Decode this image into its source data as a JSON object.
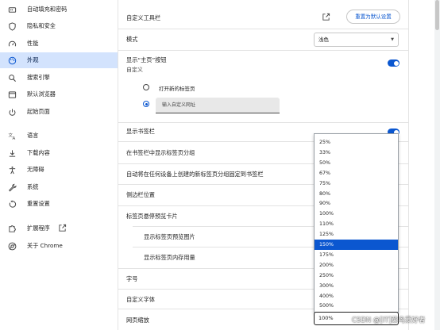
{
  "sidebar": {
    "items": [
      {
        "label": "自动填充和密码",
        "icon": "autofill-icon"
      },
      {
        "label": "隐私和安全",
        "icon": "shield-icon"
      },
      {
        "label": "性能",
        "icon": "speedometer-icon"
      },
      {
        "label": "外观",
        "icon": "palette-icon"
      },
      {
        "label": "搜索引擎",
        "icon": "search-icon"
      },
      {
        "label": "默认浏览器",
        "icon": "browser-window-icon"
      },
      {
        "label": "起始页面",
        "icon": "power-icon"
      },
      {
        "label": "语言",
        "icon": "translate-icon"
      },
      {
        "label": "下载内容",
        "icon": "download-icon"
      },
      {
        "label": "无障碍",
        "icon": "accessibility-icon"
      },
      {
        "label": "系统",
        "icon": "wrench-icon"
      },
      {
        "label": "重置设置",
        "icon": "reset-icon"
      },
      {
        "label": "扩展程序",
        "icon": "puzzle-icon"
      },
      {
        "label": "关于 Chrome",
        "icon": "chrome-icon"
      }
    ],
    "active_item": "外观"
  },
  "settings": {
    "custom_toolbar": {
      "label": "自定义工具栏",
      "reset_button": "重置为默认设置"
    },
    "mode": {
      "label": "模式",
      "value": "浅色"
    },
    "home_button": {
      "label": "显示“主页”按钮",
      "sub": "自定义",
      "enabled": true
    },
    "home_options": {
      "new_tab": "打开新的标签页",
      "custom_url_placeholder": "输入自定义网址"
    },
    "bookmarks_bar": {
      "label": "显示书签栏",
      "enabled": true
    },
    "tab_groups_in_bookmarks": {
      "label": "在书签栏中显示标签页分组"
    },
    "auto_pin_tab_groups": {
      "label": "自动将在任何设备上创建的新标签页分组固定到书签栏"
    },
    "side_panel_position": {
      "label": "侧边栏位置"
    },
    "tab_hover_preview": {
      "label": "标签页悬停预览卡片"
    },
    "show_tab_preview_image": {
      "label": "显示标签页预览图片"
    },
    "show_tab_memory_usage": {
      "label": "显示标签页内存用量"
    },
    "font_size": {
      "label": "字号"
    },
    "custom_fonts": {
      "label": "自定义字体"
    },
    "page_zoom": {
      "label": "网页缩放",
      "value": "100%"
    }
  },
  "zoom_options": [
    "25%",
    "33%",
    "50%",
    "67%",
    "75%",
    "80%",
    "90%",
    "100%",
    "110%",
    "125%",
    "150%",
    "175%",
    "200%",
    "250%",
    "300%",
    "400%",
    "500%"
  ],
  "zoom_highlighted": "150%",
  "watermark": "CSDN @[IT]菜鸟爱好者",
  "colors": {
    "accent": "#0b57d0",
    "active_nav": "#d3e3fd"
  }
}
